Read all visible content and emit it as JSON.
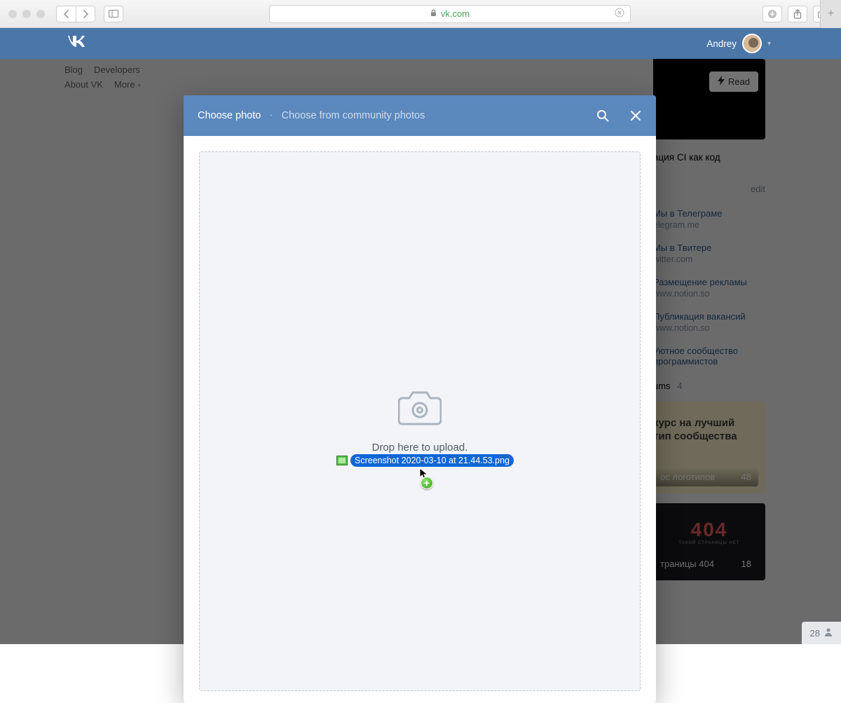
{
  "browser": {
    "url_host": "vk.com"
  },
  "vk_header": {
    "username": "Andrey"
  },
  "left_nav": {
    "blog": "Blog",
    "developers": "Developers",
    "about": "About VK",
    "more": "More"
  },
  "right_sidebar": {
    "read_button": "Read",
    "cover_title": "ация CI как код",
    "edit": "edit",
    "links": [
      {
        "title": "Мы в Телеграме",
        "sub": "elegram.me"
      },
      {
        "title": "Мы в Твитере",
        "sub": "witter.com"
      },
      {
        "title": "Размещение рекламы",
        "sub": "www.notion.so"
      },
      {
        "title": "Публикация вакансий",
        "sub": "www.notion.so"
      },
      {
        "title": "Уютное сообщество программистов",
        "sub": ""
      }
    ],
    "albums_label": "ums",
    "albums_count": "4",
    "album1": {
      "line1": "курс на лучший",
      "line2": "тип сообщества",
      "footer_name": "ос логотипов",
      "footer_count": "48"
    },
    "album2": {
      "big": "404",
      "sub": "ТАКОЙ СТРАНИЦЫ НЕТ",
      "footer_name": "траницы 404",
      "footer_count": "18"
    }
  },
  "modal": {
    "title": "Choose photo",
    "separator": "·",
    "sublink": "Choose from community photos",
    "drop_text": "Drop here to upload."
  },
  "drag": {
    "filename": "Screenshot 2020-03-10 at 21.44.53.png"
  },
  "footer": {
    "online_count": "28"
  }
}
